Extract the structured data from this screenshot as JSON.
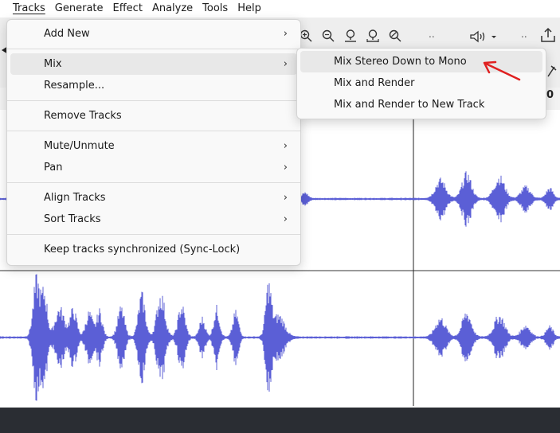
{
  "menubar": {
    "items": [
      "Tracks",
      "Generate",
      "Effect",
      "Analyze",
      "Tools",
      "Help"
    ]
  },
  "toolbar": {
    "dots1": "..",
    "dots2": ".."
  },
  "ruler": {
    "edge_digit": "0"
  },
  "tracks_menu": {
    "items": [
      {
        "label": "Add New",
        "arrow": "›"
      },
      {
        "label": "Mix",
        "arrow": "›"
      },
      {
        "label": "Resample..."
      },
      {
        "label": "Remove Tracks"
      },
      {
        "label": "Mute/Unmute",
        "arrow": "›"
      },
      {
        "label": "Pan",
        "arrow": "›"
      },
      {
        "label": "Align Tracks",
        "arrow": "›"
      },
      {
        "label": "Sort Tracks",
        "arrow": "›"
      },
      {
        "label": "Keep tracks synchronized (Sync-Lock)"
      }
    ]
  },
  "mix_submenu": {
    "items": [
      {
        "label": "Mix Stereo Down to Mono"
      },
      {
        "label": "Mix and Render"
      },
      {
        "label": "Mix and Render to New Track"
      }
    ]
  },
  "colors": {
    "waveform": "#5b5fd6",
    "annotation_arrow": "#e02020",
    "menu_bg": "#f9f9f9",
    "bottom_bar": "#2a2d33"
  }
}
